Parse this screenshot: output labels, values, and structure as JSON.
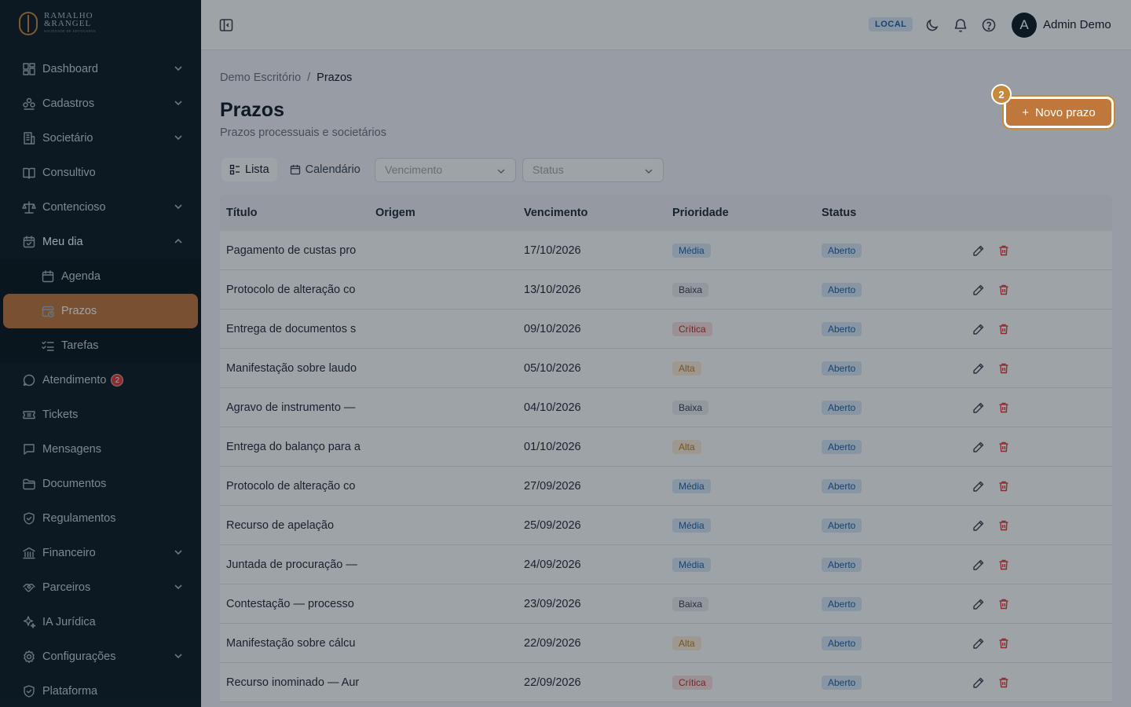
{
  "brand": {
    "line1": "RAMALHO",
    "line2": "&RANGEL",
    "line3": "SOCIEDADE DE ADVOGADOS"
  },
  "sidebar": {
    "items": [
      {
        "label": "Dashboard",
        "icon": "dashboard-icon",
        "chevron": "down"
      },
      {
        "label": "Cadastros",
        "icon": "users-icon",
        "chevron": "down"
      },
      {
        "label": "Societário",
        "icon": "building-icon",
        "chevron": "down"
      },
      {
        "label": "Consultivo",
        "icon": "book-icon"
      },
      {
        "label": "Contencioso",
        "icon": "scale-icon",
        "chevron": "down"
      },
      {
        "label": "Meu dia",
        "icon": "calendar-check-icon",
        "chevron": "up"
      }
    ],
    "sub_items": [
      {
        "label": "Agenda",
        "icon": "calendar-icon"
      },
      {
        "label": "Prazos",
        "icon": "calendar-clock-icon",
        "active": true
      },
      {
        "label": "Tarefas",
        "icon": "list-checks-icon"
      }
    ],
    "items2": [
      {
        "label": "Atendimento",
        "icon": "chat-icon",
        "badge": "2"
      },
      {
        "label": "Tickets",
        "icon": "ticket-icon"
      },
      {
        "label": "Mensagens",
        "icon": "message-icon"
      },
      {
        "label": "Documentos",
        "icon": "folder-icon"
      },
      {
        "label": "Regulamentos",
        "icon": "shield-icon"
      },
      {
        "label": "Financeiro",
        "icon": "bank-icon",
        "chevron": "down"
      },
      {
        "label": "Parceiros",
        "icon": "handshake-icon",
        "chevron": "down"
      },
      {
        "label": "IA Jurídica",
        "icon": "sparkles-icon"
      },
      {
        "label": "Configurações",
        "icon": "gear-icon",
        "chevron": "down"
      },
      {
        "label": "Plataforma",
        "icon": "shield-icon"
      }
    ]
  },
  "header": {
    "env": "LOCAL",
    "avatar_initial": "A",
    "user_name": "Admin Demo"
  },
  "breadcrumb": {
    "parent": "Demo Escritório",
    "sep": "/",
    "current": "Prazos"
  },
  "page": {
    "title": "Prazos",
    "subtitle": "Prazos processuais e societários"
  },
  "primary_action": {
    "label": "Novo prazo",
    "plus": "+",
    "step": "2"
  },
  "views": {
    "list": "Lista",
    "calendar": "Calendário"
  },
  "filters": {
    "vencimento_placeholder": "Vencimento",
    "status_placeholder": "Status"
  },
  "table": {
    "columns": [
      "Título",
      "Origem",
      "Vencimento",
      "Prioridade",
      "Status"
    ],
    "rows": [
      {
        "titulo": "Pagamento de custas pro",
        "origem": "",
        "vencimento": "17/10/2026",
        "prioridade": "Média",
        "status": "Aberto"
      },
      {
        "titulo": "Protocolo de alteração co",
        "origem": "",
        "vencimento": "13/10/2026",
        "prioridade": "Baixa",
        "status": "Aberto"
      },
      {
        "titulo": "Entrega de documentos s",
        "origem": "",
        "vencimento": "09/10/2026",
        "prioridade": "Crítica",
        "status": "Aberto"
      },
      {
        "titulo": "Manifestação sobre laudo",
        "origem": "",
        "vencimento": "05/10/2026",
        "prioridade": "Alta",
        "status": "Aberto"
      },
      {
        "titulo": "Agravo de instrumento —",
        "origem": "",
        "vencimento": "04/10/2026",
        "prioridade": "Baixa",
        "status": "Aberto"
      },
      {
        "titulo": "Entrega do balanço para a",
        "origem": "",
        "vencimento": "01/10/2026",
        "prioridade": "Alta",
        "status": "Aberto"
      },
      {
        "titulo": "Protocolo de alteração co",
        "origem": "",
        "vencimento": "27/09/2026",
        "prioridade": "Média",
        "status": "Aberto"
      },
      {
        "titulo": "Recurso de apelação",
        "origem": "",
        "vencimento": "25/09/2026",
        "prioridade": "Média",
        "status": "Aberto"
      },
      {
        "titulo": "Juntada de procuração —",
        "origem": "",
        "vencimento": "24/09/2026",
        "prioridade": "Média",
        "status": "Aberto"
      },
      {
        "titulo": "Contestação — processo",
        "origem": "",
        "vencimento": "23/09/2026",
        "prioridade": "Baixa",
        "status": "Aberto"
      },
      {
        "titulo": "Manifestação sobre cálcu",
        "origem": "",
        "vencimento": "22/09/2026",
        "prioridade": "Alta",
        "status": "Aberto"
      },
      {
        "titulo": "Recurso inominado — Aur",
        "origem": "",
        "vencimento": "22/09/2026",
        "prioridade": "Crítica",
        "status": "Aberto"
      }
    ]
  },
  "colors": {
    "sidebar_bg": "#0c1a24",
    "accent": "#c0773c",
    "info": "#1f5fa8",
    "danger": "#e03a3a",
    "warning": "#c47a1a"
  }
}
